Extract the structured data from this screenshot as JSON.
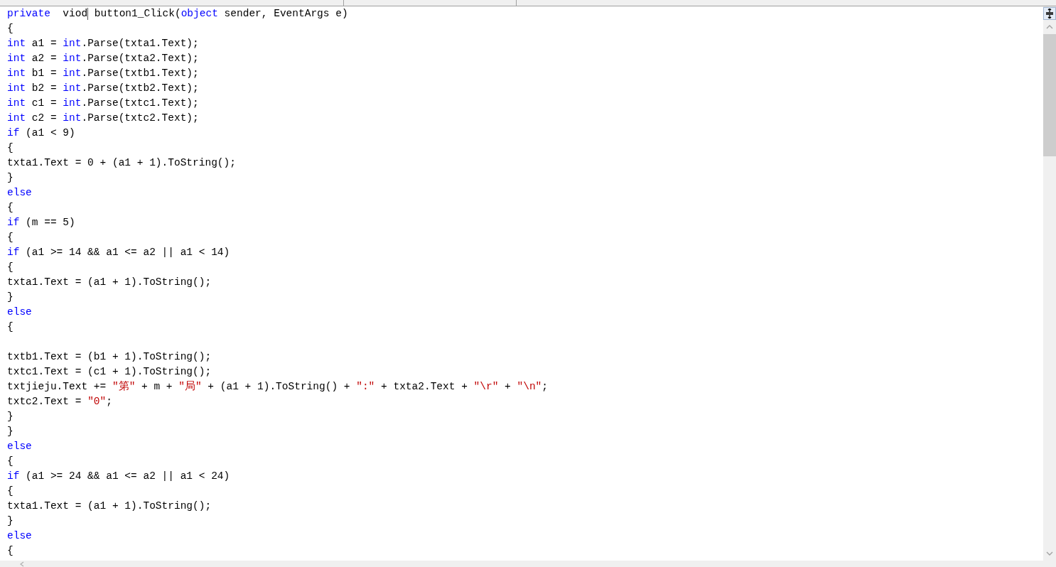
{
  "code_lines": [
    {
      "kind": "code",
      "tokens": [
        {
          "kind": "keyword",
          "text": "private"
        },
        {
          "kind": "plain",
          "text": "  viod"
        },
        {
          "kind": "cursor"
        },
        {
          "kind": "plain",
          "text": " button1_Click("
        },
        {
          "kind": "keyword",
          "text": "object"
        },
        {
          "kind": "plain",
          "text": " sender, EventArgs e)"
        }
      ]
    },
    {
      "kind": "code",
      "tokens": [
        {
          "kind": "plain",
          "text": "{"
        }
      ]
    },
    {
      "kind": "code",
      "tokens": [
        {
          "kind": "keyword",
          "text": "int"
        },
        {
          "kind": "plain",
          "text": " a1 = "
        },
        {
          "kind": "keyword",
          "text": "int"
        },
        {
          "kind": "plain",
          "text": ".Parse(txta1.Text);"
        }
      ]
    },
    {
      "kind": "code",
      "tokens": [
        {
          "kind": "keyword",
          "text": "int"
        },
        {
          "kind": "plain",
          "text": " a2 = "
        },
        {
          "kind": "keyword",
          "text": "int"
        },
        {
          "kind": "plain",
          "text": ".Parse(txta2.Text);"
        }
      ]
    },
    {
      "kind": "code",
      "tokens": [
        {
          "kind": "keyword",
          "text": "int"
        },
        {
          "kind": "plain",
          "text": " b1 = "
        },
        {
          "kind": "keyword",
          "text": "int"
        },
        {
          "kind": "plain",
          "text": ".Parse(txtb1.Text);"
        }
      ]
    },
    {
      "kind": "code",
      "tokens": [
        {
          "kind": "keyword",
          "text": "int"
        },
        {
          "kind": "plain",
          "text": " b2 = "
        },
        {
          "kind": "keyword",
          "text": "int"
        },
        {
          "kind": "plain",
          "text": ".Parse(txtb2.Text);"
        }
      ]
    },
    {
      "kind": "code",
      "tokens": [
        {
          "kind": "keyword",
          "text": "int"
        },
        {
          "kind": "plain",
          "text": " c1 = "
        },
        {
          "kind": "keyword",
          "text": "int"
        },
        {
          "kind": "plain",
          "text": ".Parse(txtc1.Text);"
        }
      ]
    },
    {
      "kind": "code",
      "tokens": [
        {
          "kind": "keyword",
          "text": "int"
        },
        {
          "kind": "plain",
          "text": " c2 = "
        },
        {
          "kind": "keyword",
          "text": "int"
        },
        {
          "kind": "plain",
          "text": ".Parse(txtc2.Text);"
        }
      ]
    },
    {
      "kind": "code",
      "tokens": [
        {
          "kind": "keyword",
          "text": "if"
        },
        {
          "kind": "plain",
          "text": " (a1 < 9)"
        }
      ]
    },
    {
      "kind": "code",
      "tokens": [
        {
          "kind": "plain",
          "text": "{"
        }
      ]
    },
    {
      "kind": "code",
      "tokens": [
        {
          "kind": "plain",
          "text": "txta1.Text = 0 + (a1 + 1).ToString();"
        }
      ]
    },
    {
      "kind": "code",
      "tokens": [
        {
          "kind": "plain",
          "text": "}"
        }
      ]
    },
    {
      "kind": "code",
      "tokens": [
        {
          "kind": "keyword",
          "text": "else"
        }
      ]
    },
    {
      "kind": "code",
      "tokens": [
        {
          "kind": "plain",
          "text": "{"
        }
      ]
    },
    {
      "kind": "code",
      "tokens": [
        {
          "kind": "keyword",
          "text": "if"
        },
        {
          "kind": "plain",
          "text": " (m == 5)"
        }
      ]
    },
    {
      "kind": "code",
      "tokens": [
        {
          "kind": "plain",
          "text": "{"
        }
      ]
    },
    {
      "kind": "code",
      "tokens": [
        {
          "kind": "keyword",
          "text": "if"
        },
        {
          "kind": "plain",
          "text": " (a1 >= 14 && a1 <= a2 || a1 < 14)"
        }
      ]
    },
    {
      "kind": "code",
      "tokens": [
        {
          "kind": "plain",
          "text": "{"
        }
      ]
    },
    {
      "kind": "code",
      "tokens": [
        {
          "kind": "plain",
          "text": "txta1.Text = (a1 + 1).ToString();"
        }
      ]
    },
    {
      "kind": "code",
      "tokens": [
        {
          "kind": "plain",
          "text": "}"
        }
      ]
    },
    {
      "kind": "code",
      "tokens": [
        {
          "kind": "keyword",
          "text": "else"
        }
      ]
    },
    {
      "kind": "code",
      "tokens": [
        {
          "kind": "plain",
          "text": "{"
        }
      ]
    },
    {
      "kind": "blank"
    },
    {
      "kind": "code",
      "tokens": [
        {
          "kind": "plain",
          "text": "txtb1.Text = (b1 + 1).ToString();"
        }
      ]
    },
    {
      "kind": "code",
      "tokens": [
        {
          "kind": "plain",
          "text": "txtc1.Text = (c1 + 1).ToString();"
        }
      ]
    },
    {
      "kind": "code",
      "tokens": [
        {
          "kind": "plain",
          "text": "txtjieju.Text += "
        },
        {
          "kind": "string",
          "text": "\"第\""
        },
        {
          "kind": "plain",
          "text": " + m + "
        },
        {
          "kind": "string",
          "text": "\"局\""
        },
        {
          "kind": "plain",
          "text": " + (a1 + 1).ToString() + "
        },
        {
          "kind": "string",
          "text": "\":\""
        },
        {
          "kind": "plain",
          "text": " + txta2.Text + "
        },
        {
          "kind": "string",
          "text": "\"\\r\""
        },
        {
          "kind": "plain",
          "text": " + "
        },
        {
          "kind": "string",
          "text": "\"\\n\""
        },
        {
          "kind": "plain",
          "text": ";"
        }
      ]
    },
    {
      "kind": "code",
      "tokens": [
        {
          "kind": "plain",
          "text": "txtc2.Text = "
        },
        {
          "kind": "string",
          "text": "\"0\""
        },
        {
          "kind": "plain",
          "text": ";"
        }
      ]
    },
    {
      "kind": "code",
      "tokens": [
        {
          "kind": "plain",
          "text": "}"
        }
      ]
    },
    {
      "kind": "code",
      "tokens": [
        {
          "kind": "plain",
          "text": "}"
        }
      ]
    },
    {
      "kind": "code",
      "tokens": [
        {
          "kind": "keyword",
          "text": "else"
        }
      ]
    },
    {
      "kind": "code",
      "tokens": [
        {
          "kind": "plain",
          "text": "{"
        }
      ]
    },
    {
      "kind": "code",
      "tokens": [
        {
          "kind": "keyword",
          "text": "if"
        },
        {
          "kind": "plain",
          "text": " (a1 >= 24 && a1 <= a2 || a1 < 24)"
        }
      ]
    },
    {
      "kind": "code",
      "tokens": [
        {
          "kind": "plain",
          "text": "{"
        }
      ]
    },
    {
      "kind": "code",
      "tokens": [
        {
          "kind": "plain",
          "text": "txta1.Text = (a1 + 1).ToString();"
        }
      ]
    },
    {
      "kind": "code",
      "tokens": [
        {
          "kind": "plain",
          "text": "}"
        }
      ]
    },
    {
      "kind": "code",
      "tokens": [
        {
          "kind": "keyword",
          "text": "else"
        }
      ]
    },
    {
      "kind": "code",
      "tokens": [
        {
          "kind": "plain",
          "text": "{"
        }
      ]
    }
  ]
}
